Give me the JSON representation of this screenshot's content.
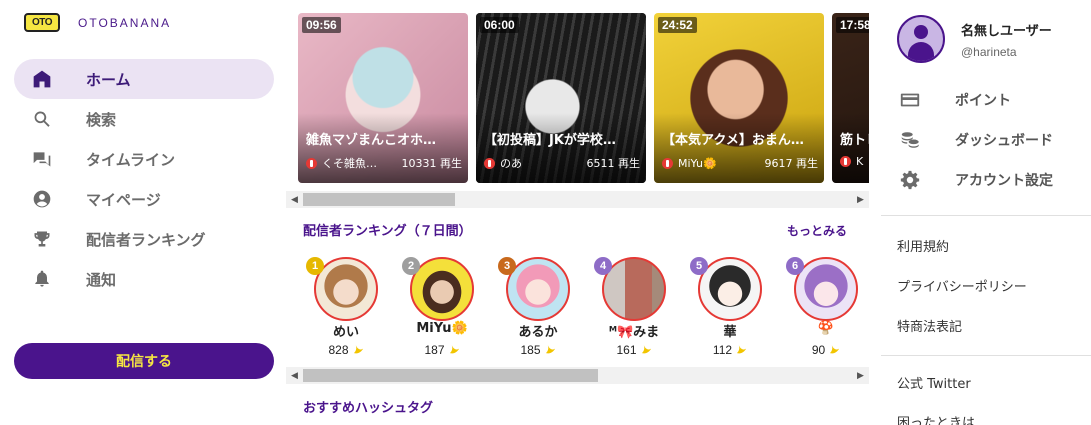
{
  "brand": {
    "logo_mark": "OTO",
    "name": "OTOBANANA"
  },
  "nav": [
    {
      "label": "ホーム",
      "icon": "home-icon",
      "active": true
    },
    {
      "label": "検索",
      "icon": "search-icon"
    },
    {
      "label": "タイムライン",
      "icon": "chat-icon"
    },
    {
      "label": "マイページ",
      "icon": "account-icon"
    },
    {
      "label": "配信者ランキング",
      "icon": "trophy-icon"
    },
    {
      "label": "通知",
      "icon": "bell-icon"
    }
  ],
  "stream_button": "配信する",
  "videos": [
    {
      "duration": "09:56",
      "title": "雑魚マゾまんこオホ…",
      "author": "くそ雑魚…",
      "plays": "10331 再生"
    },
    {
      "duration": "06:00",
      "title": "【初投稿】JKが学校…",
      "author": "のあ",
      "plays": "6511 再生"
    },
    {
      "duration": "24:52",
      "title": "【本気アクメ】おまん…",
      "author": "MiYu🌼",
      "plays": "9617 再生"
    },
    {
      "duration": "17:58",
      "title": "筋トレ",
      "author": "K",
      "plays": ""
    }
  ],
  "ranking": {
    "title": "配信者ランキング（７日間）",
    "more": "もっとみる",
    "items": [
      {
        "rank": "1",
        "name": "めい",
        "score": "828",
        "badge_color": "#e6b800"
      },
      {
        "rank": "2",
        "name": "MiYu🌼",
        "score": "187",
        "badge_color": "#9e9e9e"
      },
      {
        "rank": "3",
        "name": "あるか",
        "score": "185",
        "badge_color": "#c8691c"
      },
      {
        "rank": "4",
        "name": "ᴹ🎀みま",
        "score": "161",
        "badge_color": "#8e6cc7"
      },
      {
        "rank": "5",
        "name": "華",
        "score": "112",
        "badge_color": "#8e6cc7"
      },
      {
        "rank": "6",
        "name": "🍄",
        "score": "90",
        "badge_color": "#8e6cc7"
      }
    ]
  },
  "hashtag_title": "おすすめハッシュタグ",
  "user": {
    "name": "名無しユーザー",
    "handle": "@harineta"
  },
  "account_menu": [
    {
      "label": "ポイント",
      "icon": "credit-card-icon"
    },
    {
      "label": "ダッシュボード",
      "icon": "coins-icon"
    },
    {
      "label": "アカウント設定",
      "icon": "gear-icon"
    }
  ],
  "links": [
    "利用規約",
    "プライバシーポリシー",
    "特商法表記",
    "公式 Twitter",
    "困ったときは"
  ],
  "colors": {
    "brand_purple": "#4a148c",
    "brand_yellow": "#f5e642",
    "active_bg": "#ebe3f3",
    "live_red": "#e53935"
  }
}
